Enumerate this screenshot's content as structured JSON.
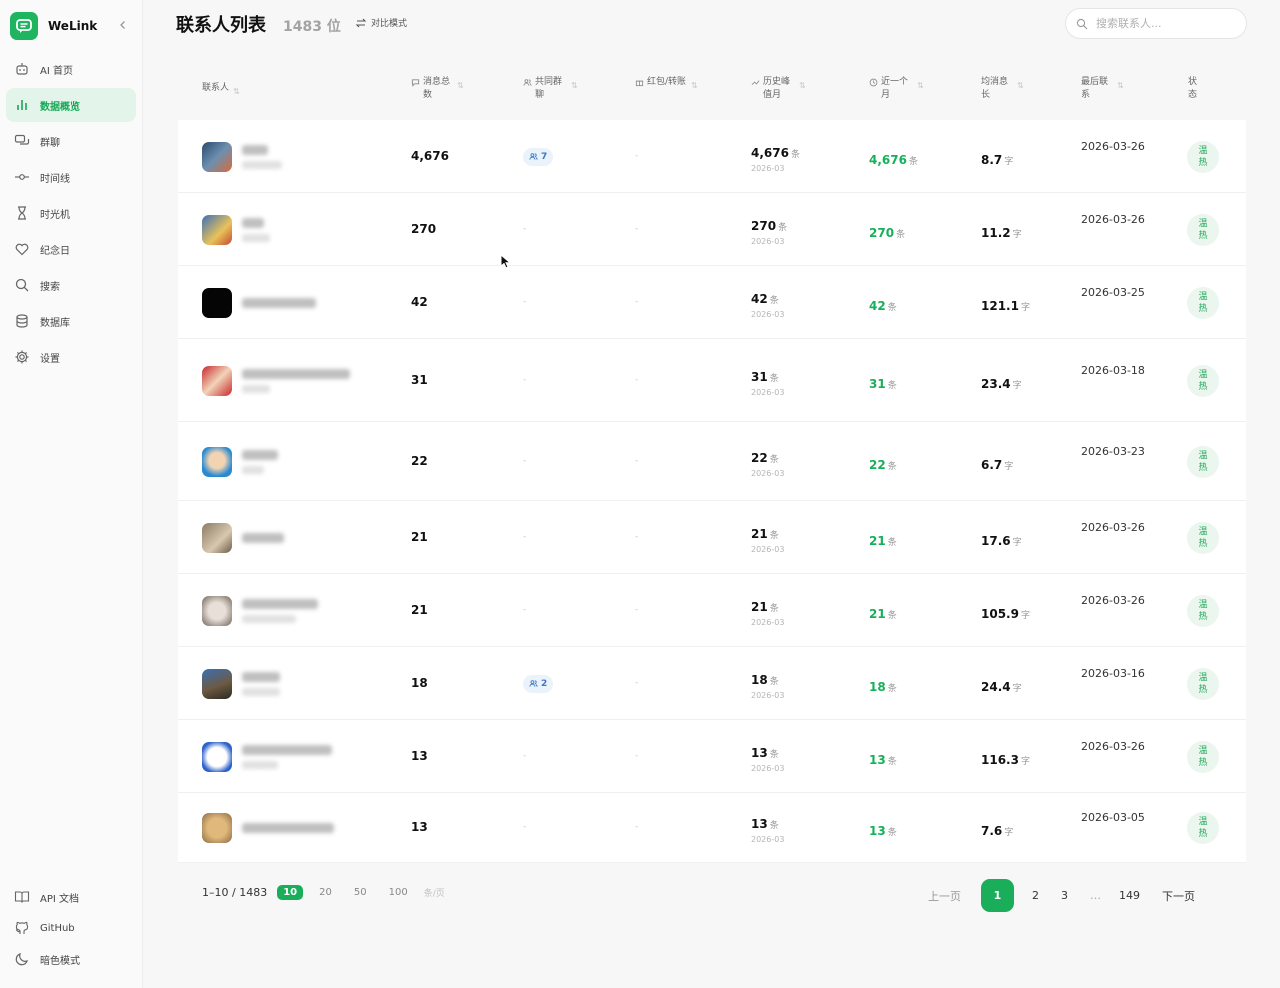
{
  "app": {
    "name": "WeLink"
  },
  "sidebar": {
    "items": [
      {
        "label": "AI 首页",
        "icon": "robot-icon"
      },
      {
        "label": "数据概览",
        "icon": "bar-chart-icon",
        "active": true
      },
      {
        "label": "群聊",
        "icon": "chat-icon"
      },
      {
        "label": "时间线",
        "icon": "timeline-icon"
      },
      {
        "label": "时光机",
        "icon": "hourglass-icon"
      },
      {
        "label": "纪念日",
        "icon": "heart-icon"
      },
      {
        "label": "搜索",
        "icon": "search-icon"
      },
      {
        "label": "数据库",
        "icon": "database-icon"
      },
      {
        "label": "设置",
        "icon": "gear-icon"
      }
    ],
    "bottom": [
      {
        "label": "API 文档",
        "icon": "book-icon"
      },
      {
        "label": "GitHub",
        "icon": "github-icon"
      },
      {
        "label": "暗色模式",
        "icon": "moon-icon"
      }
    ]
  },
  "header": {
    "title": "联系人列表",
    "count": "1483 位",
    "compare_label": "对比模式",
    "search_placeholder": "搜索联系人..."
  },
  "table": {
    "columns": [
      {
        "label": "联系人",
        "icon": null
      },
      {
        "label": "消息总数",
        "icon": "message-icon"
      },
      {
        "label": "共同群聊",
        "icon": "users-icon"
      },
      {
        "label": "红包/转账",
        "icon": "gift-icon"
      },
      {
        "label": "历史峰值月",
        "icon": "trend-icon"
      },
      {
        "label": "近一个月",
        "icon": "clock-icon"
      },
      {
        "label": "均消息长",
        "icon": null
      },
      {
        "label": "最后联系",
        "icon": null
      },
      {
        "label": "状态",
        "icon": null
      }
    ],
    "rows": [
      {
        "total": "4,676",
        "groups": "7",
        "redpacket": "-",
        "peak": "4,676",
        "peak_unit": "条",
        "peak_month": "2026-03",
        "recent": "4,676",
        "recent_unit": "条",
        "avg": "8.7",
        "avg_unit": "字",
        "last": "2026-03-26",
        "status": "温热"
      },
      {
        "total": "270",
        "groups": "-",
        "redpacket": "-",
        "peak": "270",
        "peak_unit": "条",
        "peak_month": "2026-03",
        "recent": "270",
        "recent_unit": "条",
        "avg": "11.2",
        "avg_unit": "字",
        "last": "2026-03-26",
        "status": "温热"
      },
      {
        "total": "42",
        "groups": "-",
        "redpacket": "-",
        "peak": "42",
        "peak_unit": "条",
        "peak_month": "2026-03",
        "recent": "42",
        "recent_unit": "条",
        "avg": "121.1",
        "avg_unit": "字",
        "last": "2026-03-25",
        "status": "温热"
      },
      {
        "total": "31",
        "groups": "-",
        "redpacket": "-",
        "peak": "31",
        "peak_unit": "条",
        "peak_month": "2026-03",
        "recent": "31",
        "recent_unit": "条",
        "avg": "23.4",
        "avg_unit": "字",
        "last": "2026-03-18",
        "status": "温热"
      },
      {
        "total": "22",
        "groups": "-",
        "redpacket": "-",
        "peak": "22",
        "peak_unit": "条",
        "peak_month": "2026-03",
        "recent": "22",
        "recent_unit": "条",
        "avg": "6.7",
        "avg_unit": "字",
        "last": "2026-03-23",
        "status": "温热"
      },
      {
        "total": "21",
        "groups": "-",
        "redpacket": "-",
        "peak": "21",
        "peak_unit": "条",
        "peak_month": "2026-03",
        "recent": "21",
        "recent_unit": "条",
        "avg": "17.6",
        "avg_unit": "字",
        "last": "2026-03-26",
        "status": "温热"
      },
      {
        "total": "21",
        "groups": "-",
        "redpacket": "-",
        "peak": "21",
        "peak_unit": "条",
        "peak_month": "2026-03",
        "recent": "21",
        "recent_unit": "条",
        "avg": "105.9",
        "avg_unit": "字",
        "last": "2026-03-26",
        "status": "温热"
      },
      {
        "total": "18",
        "groups": "2",
        "redpacket": "-",
        "peak": "18",
        "peak_unit": "条",
        "peak_month": "2026-03",
        "recent": "18",
        "recent_unit": "条",
        "avg": "24.4",
        "avg_unit": "字",
        "last": "2026-03-16",
        "status": "温热"
      },
      {
        "total": "13",
        "groups": "-",
        "redpacket": "-",
        "peak": "13",
        "peak_unit": "条",
        "peak_month": "2026-03",
        "recent": "13",
        "recent_unit": "条",
        "avg": "116.3",
        "avg_unit": "字",
        "last": "2026-03-26",
        "status": "温热"
      },
      {
        "total": "13",
        "groups": "-",
        "redpacket": "-",
        "peak": "13",
        "peak_unit": "条",
        "peak_month": "2026-03",
        "recent": "13",
        "recent_unit": "条",
        "avg": "7.6",
        "avg_unit": "字",
        "last": "2026-03-05",
        "status": "温热"
      }
    ]
  },
  "pagination": {
    "range": "1–10 / 1483",
    "page_sizes": [
      "10",
      "20",
      "50",
      "100"
    ],
    "page_size_selected": "10",
    "page_size_unit": "条/页",
    "prev_label": "上一页",
    "pages": [
      "1",
      "2",
      "3",
      "…",
      "149"
    ],
    "current_page": "1",
    "next_label": "下一页"
  },
  "colors": {
    "accent": "#1aae5a",
    "active_nav_bg": "#e3f5ea",
    "status_bg": "#eaf6ee",
    "group_badge_bg": "#eaf2fb"
  }
}
